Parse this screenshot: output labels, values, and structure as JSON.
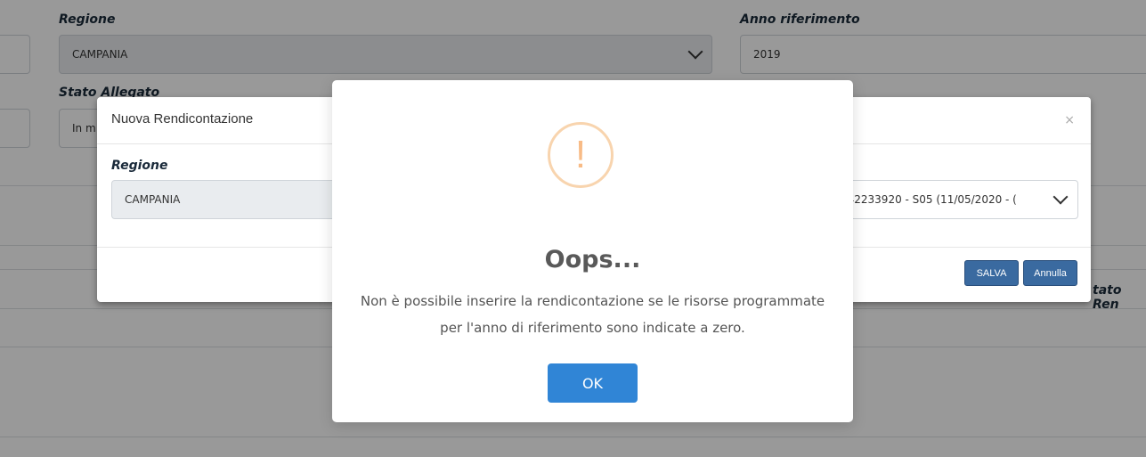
{
  "background_form": {
    "regione_label": "Regione",
    "regione_value": "CAMPANIA",
    "anno_label": "Anno riferimento",
    "anno_value": "2019",
    "stato_allegato_label": "Stato Allegato",
    "stato_allegato_value": "In m",
    "stato_ren_label": "tato Ren"
  },
  "modal": {
    "title": "Nuova Rendicontazione",
    "close_symbol": "×",
    "regione_label": "Regione",
    "regione_value": "CAMPANIA",
    "select_value": "142233920 - S05 (11/05/2020 - (",
    "save_label": "SALVA",
    "cancel_label": "Annulla"
  },
  "alert": {
    "icon_symbol": "!",
    "title": "Oops...",
    "message": "Non è possibile inserire la rendicontazione se le risorse programmate per l'anno di riferimento sono indicate a zero.",
    "ok_label": "OK"
  },
  "colors": {
    "ok_button": "#3085d6",
    "warning_icon": "#f8bb86",
    "modal_button": "#3a6aa0"
  }
}
